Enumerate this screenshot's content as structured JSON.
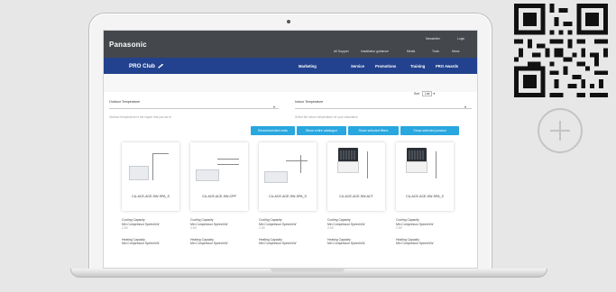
{
  "site": {
    "logo": "Panasonic",
    "top_links": [
      "Newsletter",
      "Login",
      "All Support",
      "Installation guidance",
      "Media",
      "Tools",
      "News"
    ],
    "brand": "PRO Club",
    "nav": [
      "Marketing",
      "Tools",
      "Service",
      "Promotions",
      "Training",
      "PRO Awards"
    ]
  },
  "filters": {
    "sort_label": "Sort",
    "sort_value": "List",
    "outdoor_label": "Outdoor Temperature",
    "outdoor_hint": "Outdoor temperature to the region that you are in",
    "indoor_label": "Indoor Temperature",
    "indoor_hint": "Select the indoor temperature for your calculation",
    "buttons": [
      "Recommended units",
      "Show entire catalogue",
      "Show selected filters",
      "Show selected product"
    ]
  },
  "products": [
    {
      "model": "CU-ACE-ACE-SW-SPA_S",
      "type": "wall"
    },
    {
      "model": "CU-ACE-ACE-SW-CPP",
      "type": "wall"
    },
    {
      "model": "CU-ACE-ACE-SW-SPA_S",
      "type": "wall"
    },
    {
      "model": "CU-ACE-ACE-SW-ACT",
      "type": "duct"
    },
    {
      "model": "CU-ACE-ACE-SW-SPA_S",
      "type": "duct"
    }
  ],
  "specs": [
    {
      "l1": "Cooling Capacity",
      "l2": "Min Compressor Speed kW",
      "v": "2.50",
      "l3": "Heating Capacity",
      "l4": "Min Compressor Speed kW"
    },
    {
      "l1": "Cooling Capacity",
      "l2": "Min Compressor Speed kW",
      "v": "2.50",
      "l3": "Heating Capacity",
      "l4": "Min Compressor Speed kW"
    },
    {
      "l1": "Cooling Capacity",
      "l2": "Min Compressor Speed kW",
      "v": "2.50",
      "l3": "Heating Capacity",
      "l4": "Min Compressor Speed kW"
    },
    {
      "l1": "Cooling Capacity",
      "l2": "Min Compressor Speed kW",
      "v": "2.50",
      "l3": "Heating Capacity",
      "l4": "Min Compressor Speed kW"
    },
    {
      "l1": "Cooling Capacity",
      "l2": "Min Compressor Speed kW",
      "v": "2.50",
      "l3": "Heating Capacity",
      "l4": "Min Compressor Speed kW"
    }
  ],
  "icons": {
    "qr": "qr-code-icon",
    "plus": "plus-circle-icon"
  }
}
